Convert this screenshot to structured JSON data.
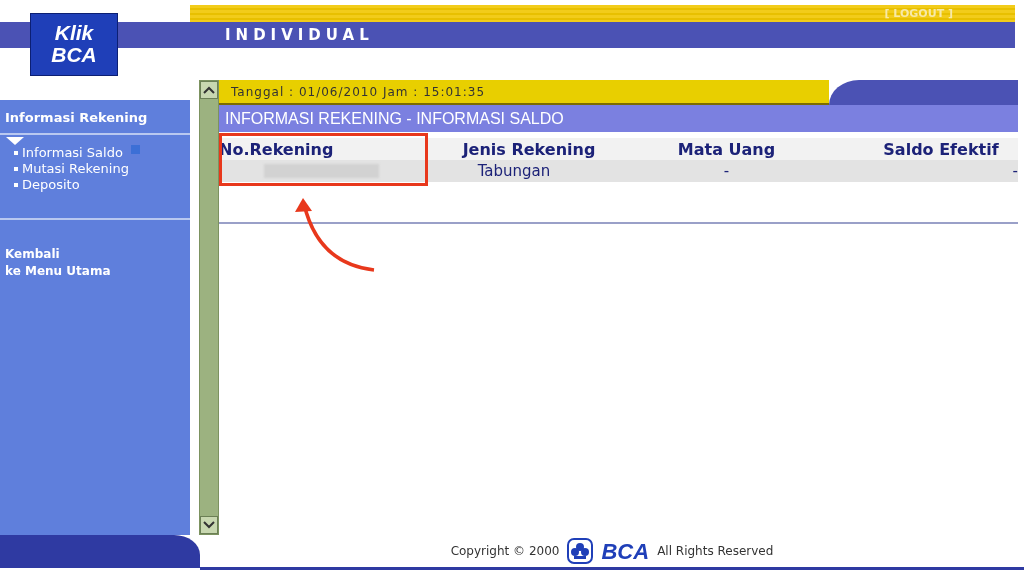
{
  "header": {
    "logo": {
      "line1": "Klik",
      "line2": "BCA"
    },
    "section": "INDIVIDUAL",
    "logout": "[ LOGOUT ]"
  },
  "sidebar": {
    "heading": "Informasi Rekening",
    "expanded": true,
    "items": [
      {
        "label": "Informasi Saldo",
        "selected": true
      },
      {
        "label": "Mutasi Rekening",
        "selected": false
      },
      {
        "label": "Deposito",
        "selected": false
      }
    ],
    "back_link": {
      "line1": "Kembali",
      "line2": "ke Menu Utama"
    }
  },
  "date_bar": "Tanggal : 01/06/2010 Jam : 15:01:35",
  "page_title": "INFORMASI REKENING - INFORMASI SALDO",
  "table": {
    "columns": [
      "No.Rekening",
      "Jenis Rekening",
      "Mata Uang",
      "Saldo Efektif"
    ],
    "rows": [
      {
        "account_number_hidden": true,
        "cells": [
          "",
          "Tabungan",
          "-",
          "-"
        ]
      }
    ]
  },
  "footer": {
    "copyright": "Copyright © 2000",
    "brand": "BCA",
    "rights": "All Rights Reserved"
  }
}
